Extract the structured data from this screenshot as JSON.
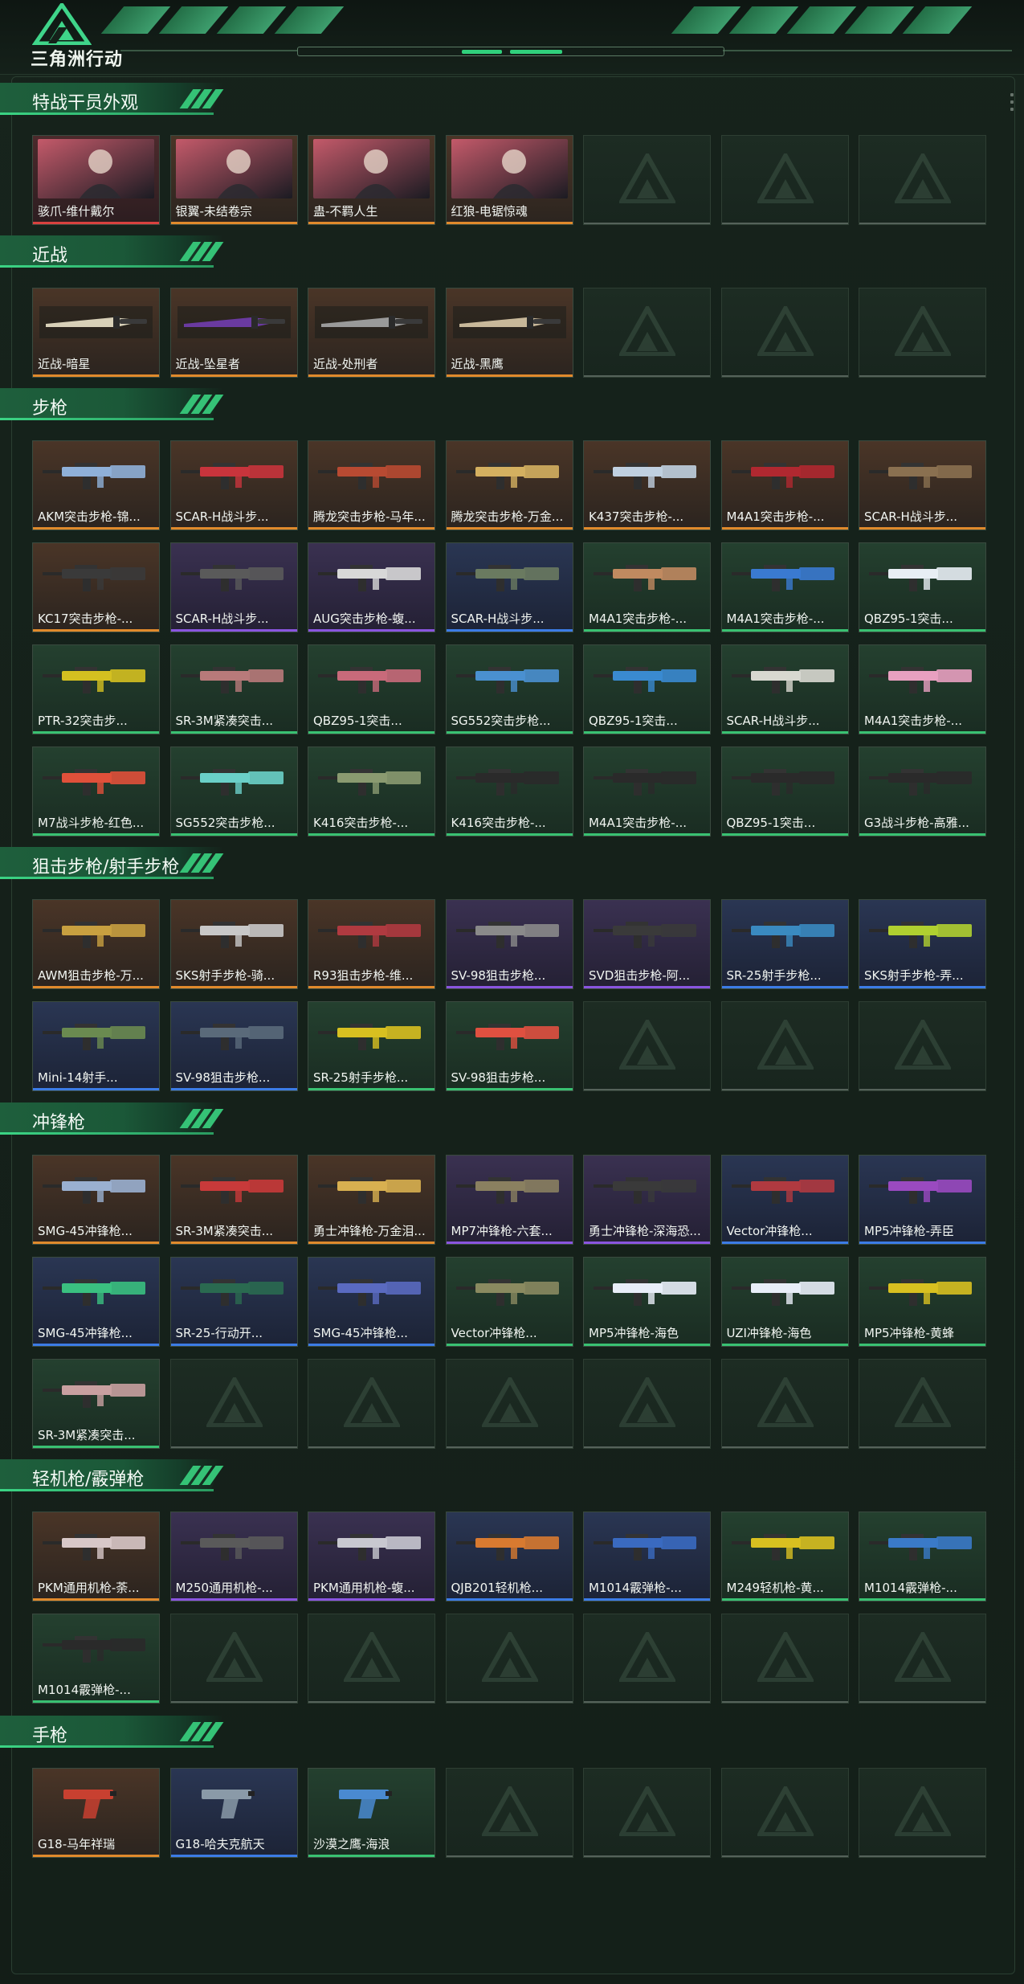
{
  "header": {
    "brand": "三角洲行动"
  },
  "sections": [
    {
      "title": "特战干员外观",
      "kind": "portrait",
      "items": [
        {
          "label": "骇爪-维什戴尔",
          "rarity": "red",
          "color": "#c45a6a"
        },
        {
          "label": "银翼-未结卷宗",
          "rarity": "orange",
          "color": "#5a6a7a"
        },
        {
          "label": "蛊-不羁人生",
          "rarity": "orange",
          "color": "#7a4aa0"
        },
        {
          "label": "红狼-电锯惊魂",
          "rarity": "orange",
          "color": "#8a3a3a"
        },
        null,
        null,
        null
      ]
    },
    {
      "title": "近战",
      "kind": "knife",
      "items": [
        {
          "label": "近战-暗星",
          "rarity": "orange",
          "color": "#d8d0b8"
        },
        {
          "label": "近战-坠星者",
          "rarity": "orange",
          "color": "#6a3aa0"
        },
        {
          "label": "近战-处刑者",
          "rarity": "orange",
          "color": "#9a9a9a"
        },
        {
          "label": "近战-黑鹰",
          "rarity": "orange",
          "color": "#c8b89a"
        },
        null,
        null,
        null
      ]
    },
    {
      "title": "步枪",
      "kind": "gun",
      "items": [
        {
          "label": "AKM突击步枪-锦...",
          "rarity": "orange",
          "color": "#8fb0d8"
        },
        {
          "label": "SCAR-H战斗步...",
          "rarity": "orange",
          "color": "#c8343c"
        },
        {
          "label": "腾龙突击步枪-马年...",
          "rarity": "orange",
          "color": "#b84a32"
        },
        {
          "label": "腾龙突击步枪-万金...",
          "rarity": "orange",
          "color": "#d4b060"
        },
        {
          "label": "K437突击步枪-...",
          "rarity": "orange",
          "color": "#c0d0e0"
        },
        {
          "label": "M4A1突击步枪-...",
          "rarity": "orange",
          "color": "#b02830"
        },
        {
          "label": "SCAR-H战斗步...",
          "rarity": "orange",
          "color": "#8a7050"
        },
        {
          "label": "KC17突击步枪-...",
          "rarity": "orange",
          "color": "#3a3a3a"
        },
        {
          "label": "SCAR-H战斗步...",
          "rarity": "purple",
          "color": "#5a5a5a"
        },
        {
          "label": "AUG突击步枪-蝮...",
          "rarity": "purple",
          "color": "#d8d8d8"
        },
        {
          "label": "SCAR-H战斗步...",
          "rarity": "blue",
          "color": "#6a7a60"
        },
        {
          "label": "M4A1突击步枪-...",
          "rarity": "green",
          "color": "#c08a60"
        },
        {
          "label": "M4A1突击步枪-...",
          "rarity": "green",
          "color": "#3a7ad0"
        },
        {
          "label": "QBZ95-1突击...",
          "rarity": "green",
          "color": "#e8eef4"
        },
        {
          "label": "PTR-32突击步...",
          "rarity": "green",
          "color": "#d4c020"
        },
        {
          "label": "SR-3M紧凑突击...",
          "rarity": "green",
          "color": "#b87a7a"
        },
        {
          "label": "QBZ95-1突击...",
          "rarity": "green",
          "color": "#c86a7a"
        },
        {
          "label": "SG552突击步枪...",
          "rarity": "green",
          "color": "#4a90d0"
        },
        {
          "label": "QBZ95-1突击...",
          "rarity": "green",
          "color": "#3a8ad0"
        },
        {
          "label": "SCAR-H战斗步...",
          "rarity": "green",
          "color": "#d8d8d0"
        },
        {
          "label": "M4A1突击步枪-...",
          "rarity": "green",
          "color": "#e8a0c0"
        },
        {
          "label": "M7战斗步枪-红色...",
          "rarity": "green",
          "color": "#e0503a"
        },
        {
          "label": "SG552突击步枪...",
          "rarity": "green",
          "color": "#6ad0c8"
        },
        {
          "label": "K416突击步枪-...",
          "rarity": "green",
          "color": "#8a9a70"
        },
        {
          "label": "K416突击步枪-...",
          "rarity": "green",
          "color": "#2a2a2a"
        },
        {
          "label": "M4A1突击步枪-...",
          "rarity": "green",
          "color": "#2a2a2a"
        },
        {
          "label": "QBZ95-1突击...",
          "rarity": "green",
          "color": "#2a2a2a"
        },
        {
          "label": "G3战斗步枪-高雅...",
          "rarity": "green",
          "color": "#2a2a2a"
        }
      ]
    },
    {
      "title": "狙击步枪/射手步枪",
      "kind": "gun",
      "items": [
        {
          "label": "AWM狙击步枪-万...",
          "rarity": "orange",
          "color": "#c8a040"
        },
        {
          "label": "SKS射手步枪-骑...",
          "rarity": "orange",
          "color": "#c8c8c8"
        },
        {
          "label": "R93狙击步枪-维...",
          "rarity": "orange",
          "color": "#b03a40"
        },
        {
          "label": "SV-98狙击步枪...",
          "rarity": "purple",
          "color": "#8a8a8a"
        },
        {
          "label": "SVD狙击步枪-阿...",
          "rarity": "purple",
          "color": "#3a3a3a"
        },
        {
          "label": "SR-25射手步枪...",
          "rarity": "blue",
          "color": "#3a8ac0"
        },
        {
          "label": "SKS射手步枪-弄...",
          "rarity": "blue",
          "color": "#b0d030"
        },
        {
          "label": "Mini-14射手...",
          "rarity": "blue",
          "color": "#6a8a50"
        },
        {
          "label": "SV-98狙击步枪...",
          "rarity": "blue",
          "color": "#5a6a7a"
        },
        {
          "label": "SR-25射手步枪...",
          "rarity": "green",
          "color": "#d8c020"
        },
        {
          "label": "SV-98狙击步枪...",
          "rarity": "green",
          "color": "#e05040"
        },
        null,
        null,
        null
      ]
    },
    {
      "title": "冲锋枪",
      "kind": "gun",
      "items": [
        {
          "label": "SMG-45冲锋枪...",
          "rarity": "orange",
          "color": "#9ab0d0"
        },
        {
          "label": "SR-3M紧凑突击...",
          "rarity": "orange",
          "color": "#c83a3a"
        },
        {
          "label": "勇士冲锋枪-万金泪...",
          "rarity": "orange",
          "color": "#d8b050"
        },
        {
          "label": "MP7冲锋枪-六套...",
          "rarity": "purple",
          "color": "#8a8060"
        },
        {
          "label": "勇士冲锋枪-深海恐...",
          "rarity": "purple",
          "color": "#3a3a3a"
        },
        {
          "label": "Vector冲锋枪...",
          "rarity": "blue",
          "color": "#b03a40"
        },
        {
          "label": "MP5冲锋枪-弄臣",
          "rarity": "blue",
          "color": "#9a4ac0"
        },
        {
          "label": "SMG-45冲锋枪...",
          "rarity": "blue",
          "color": "#3ac080"
        },
        {
          "label": "SR-25-行动开...",
          "rarity": "blue",
          "color": "#2a6a50"
        },
        {
          "label": "SMG-45冲锋枪...",
          "rarity": "blue",
          "color": "#5a6ac0"
        },
        {
          "label": "Vector冲锋枪...",
          "rarity": "green",
          "color": "#8a8a60"
        },
        {
          "label": "MP5冲锋枪-海色",
          "rarity": "green",
          "color": "#e8eef8"
        },
        {
          "label": "UZI冲锋枪-海色",
          "rarity": "green",
          "color": "#e8eef8"
        },
        {
          "label": "MP5冲锋枪-黄蜂",
          "rarity": "green",
          "color": "#d8c020"
        },
        {
          "label": "SR-3M紧凑突击...",
          "rarity": "green",
          "color": "#c8a0a0"
        },
        null,
        null,
        null,
        null,
        null,
        null
      ]
    },
    {
      "title": "轻机枪/霰弹枪",
      "kind": "gun",
      "items": [
        {
          "label": "PKM通用机枪-荼...",
          "rarity": "orange",
          "color": "#d8c8c8"
        },
        {
          "label": "M250通用机枪-...",
          "rarity": "purple",
          "color": "#5a5a5a"
        },
        {
          "label": "PKM通用机枪-蝮...",
          "rarity": "purple",
          "color": "#c8c8d0"
        },
        {
          "label": "QJB201轻机枪...",
          "rarity": "blue",
          "color": "#d87a30"
        },
        {
          "label": "M1014霰弹枪-...",
          "rarity": "blue",
          "color": "#3a6ac0"
        },
        {
          "label": "M249轻机枪-黄...",
          "rarity": "green",
          "color": "#d8c020"
        },
        {
          "label": "M1014霰弹枪-...",
          "rarity": "green",
          "color": "#3a7ac8"
        },
        {
          "label": "M1014霰弹枪-...",
          "rarity": "green",
          "color": "#2a2a2a"
        },
        null,
        null,
        null,
        null,
        null,
        null
      ]
    },
    {
      "title": "手枪",
      "kind": "pistol",
      "items": [
        {
          "label": "G18-马年祥瑞",
          "rarity": "orange",
          "color": "#c84030"
        },
        {
          "label": "G18-哈夫克航天",
          "rarity": "blue",
          "color": "#8a9aa8"
        },
        {
          "label": "沙漠之鹰-海浪",
          "rarity": "green",
          "color": "#4a8ad0"
        },
        null,
        null,
        null,
        null
      ]
    }
  ]
}
